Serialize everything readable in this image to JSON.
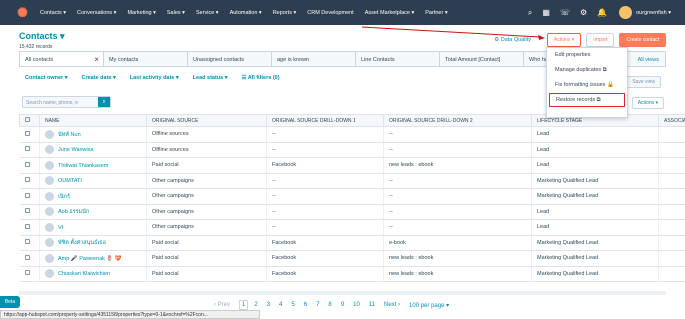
{
  "nav": {
    "items": [
      "Contacts ▾",
      "Conversations ▾",
      "Marketing ▾",
      "Sales ▾",
      "Service ▾",
      "Automation ▾",
      "Reports ▾",
      "CRM Development",
      "Asset Marketplace ▾",
      "Partner ▾"
    ],
    "account": "ourgreenfish ▾"
  },
  "header": {
    "title": "Contacts ▾",
    "count": "15,432 records"
  },
  "buttons": {
    "data_quality": "Data Quality",
    "actions": "Actions ▾",
    "import": "Import",
    "create": "Create contact"
  },
  "tabs": [
    "All contacts",
    "My contacts",
    "Unassigned contacts",
    "age is known",
    "Line Contacts",
    "Total Amount [Contact]",
    "Who have evaluated"
  ],
  "all_views": "All views",
  "filters": [
    "Contact owner ▾",
    "Create date ▾",
    "Last activity date ▾",
    "Lead status ▾",
    "☰ All filters (0)"
  ],
  "save_view": "Save view",
  "search_placeholder": "Search name, phone, e",
  "table_actions": "Actions ▾",
  "columns": [
    "NAME",
    "ORIGINAL SOURCE",
    "ORIGINAL SOURCE DRILL-DOWN 1",
    "ORIGINAL SOURCE DRILL-DOWN 2",
    "LIFECYCLE STAGE",
    "ASSOCIATED DEAL"
  ],
  "rows": [
    {
      "name": "นัทท์ Nun",
      "src": "Offline sources",
      "d1": "--",
      "d2": "--",
      "stage": "Lead",
      "deal": ""
    },
    {
      "name": "June Wanwisa",
      "src": "Offline sources",
      "d1": "--",
      "d2": "--",
      "stage": "Lead",
      "deal": ""
    },
    {
      "name": "Thitiwat Thiankasem",
      "src": "Paid social",
      "d1": "Facebook",
      "d2": "new leads : ebook",
      "stage": "Lead",
      "deal": ""
    },
    {
      "name": "OUMTATI",
      "src": "Other campaigns",
      "d1": "--",
      "d2": "--",
      "stage": "Marketing Qualified Lead",
      "deal": ""
    },
    {
      "name": "เนิกร์",
      "src": "Other campaigns",
      "d1": "--",
      "d2": "--",
      "stage": "Marketing Qualified Lead",
      "deal": ""
    },
    {
      "name": "Aob ธรรมนัก",
      "src": "Other campaigns",
      "d1": "--",
      "d2": "--",
      "stage": "Lead",
      "deal": ""
    },
    {
      "name": "VI",
      "src": "Other campaigns",
      "d1": "--",
      "d2": "--",
      "stage": "Lead",
      "deal": ""
    },
    {
      "name": "พัชิต ตั้งศาสนุนธ์เธอ",
      "src": "Paid social",
      "d1": "Facebook",
      "d2": "e-book",
      "stage": "Marketing Qualified Lead",
      "deal": ""
    },
    {
      "name": "Amp 🎤 Paweenak 🌷 💝",
      "src": "Paid social",
      "d1": "Facebook",
      "d2": "new leads : ebook",
      "stage": "Marketing Qualified Lead",
      "deal": ""
    },
    {
      "name": "Chiaskan Klaiwichien",
      "src": "Paid social",
      "d1": "Facebook",
      "d2": "new leads : ebook",
      "stage": "Marketing Qualified Lead",
      "deal": ""
    }
  ],
  "dropdown": [
    "Edit properties",
    "Manage duplicates ⧉",
    "Fix formatting issues 🔒",
    "Restore records ⧉"
  ],
  "pager": {
    "prev": "‹ Prev",
    "pages": [
      "1",
      "2",
      "3",
      "4",
      "5",
      "6",
      "7",
      "8",
      "9",
      "10",
      "11"
    ],
    "next": "Next ›",
    "per_page": "100 per page ▾"
  },
  "status_url": "https://app-hubspot.com/property-settings/4351158/properties?type=0-1&eschref=%2Fcon...",
  "beta": "Beta"
}
